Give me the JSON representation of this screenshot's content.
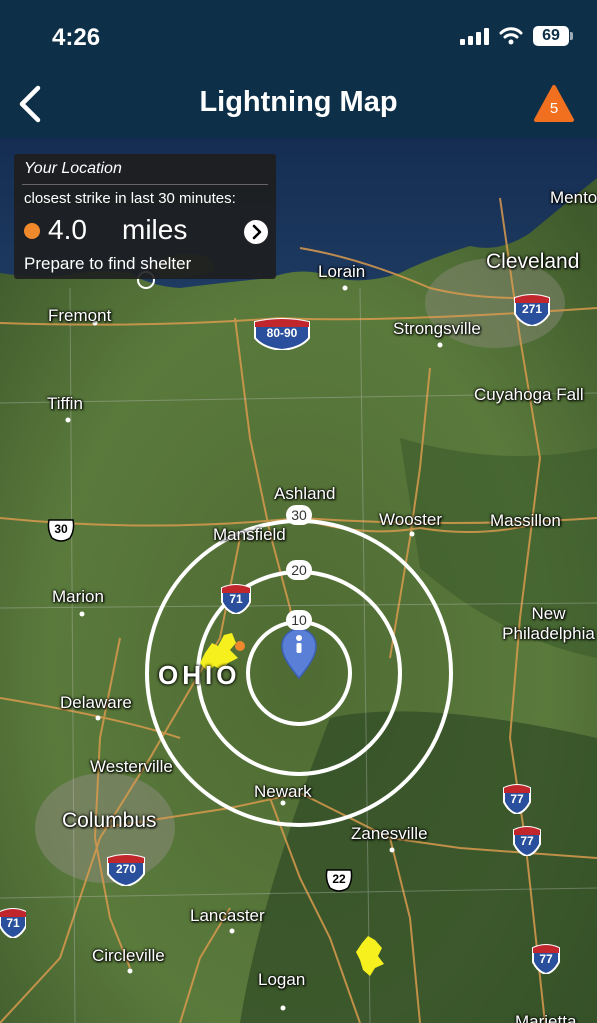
{
  "status_bar": {
    "time": "4:26",
    "battery": "69"
  },
  "nav": {
    "title": "Lightning Map",
    "alert_count": "5"
  },
  "info_panel": {
    "header": "Your Location",
    "subtitle": "closest strike in last 30 minutes:",
    "distance": "4.0",
    "unit": "miles",
    "advice": "Prepare to find shelter"
  },
  "map": {
    "region_label": "OHIO",
    "rings": [
      "30",
      "20",
      "10"
    ],
    "cities": {
      "mentor": "Mento",
      "cleveland": "Cleveland",
      "lorain": "Lorain",
      "fremont": "Fremont",
      "strongsville": "Strongsville",
      "tiffin": "Tiffin",
      "cuyahoga_falls": "Cuyahoga Fall",
      "ashland": "Ashland",
      "wooster": "Wooster",
      "massillon": "Massillon",
      "mansfield": "Mansfield",
      "marion": "Marion",
      "new_philadelphia": "New Philadelphia",
      "delaware": "Delaware",
      "westerville": "Westerville",
      "newark": "Newark",
      "columbus": "Columbus",
      "zanesville": "Zanesville",
      "lancaster": "Lancaster",
      "circleville": "Circleville",
      "logan": "Logan",
      "marietta": "Marietta"
    },
    "highways": {
      "i80_90": "80-90",
      "i271": "271",
      "us30": "30",
      "i71_north": "71",
      "i77_a": "77",
      "i77_b": "77",
      "i77_c": "77",
      "i270": "270",
      "us22": "22",
      "i71_south": "71"
    }
  },
  "colors": {
    "header_bg": "#0d2f47",
    "alert": "#f07020",
    "strike_dot": "#f0892c",
    "lightning": "#f5f01e",
    "pin": "#5a7fd6"
  }
}
